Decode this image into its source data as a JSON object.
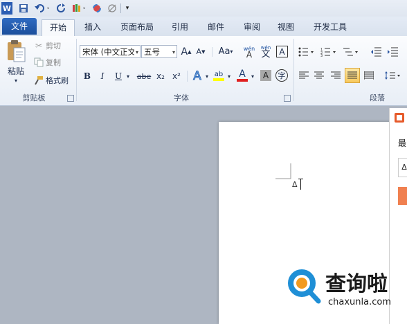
{
  "qat": {
    "icons": [
      "word-logo-icon",
      "save-icon",
      "undo-icon",
      "redo-icon",
      "format-painter-icon",
      "color-icon",
      "clear-icon",
      "customize-icon"
    ]
  },
  "tabs": {
    "file": "文件",
    "items": [
      "开始",
      "插入",
      "页面布局",
      "引用",
      "邮件",
      "审阅",
      "视图",
      "开发工具"
    ]
  },
  "clipboard": {
    "paste": "粘贴",
    "cut": "剪切",
    "copy": "复制",
    "format_painter": "格式刷",
    "group_label": "剪贴板"
  },
  "font": {
    "font_name": "宋体 (中文正文",
    "font_size": "五号",
    "grow": "A",
    "shrink": "A",
    "change_case": "Aa",
    "wen": "wén",
    "wen_char": "文",
    "boxed_a": "A",
    "bold": "B",
    "italic": "I",
    "underline": "U",
    "strike": "abe",
    "subscript": "x₂",
    "superscript": "x²",
    "effects": "A",
    "highlight": "ab",
    "font_color": "A",
    "char_shade": "A",
    "enclose": "字",
    "group_label": "字体"
  },
  "paragraph": {
    "group_label": "段落"
  },
  "side": {
    "heading": "最",
    "symbol": "Δ"
  },
  "document": {
    "marker": "Δ"
  },
  "watermark": {
    "text": "查询啦",
    "domain": "chaxunla.com"
  },
  "colors": {
    "file_tab": "#2a64b8",
    "highlight": "#ffff00",
    "font_color": "#e02020",
    "side_orange": "#f08050",
    "watermark_blue": "#1f8fd6",
    "watermark_orange": "#f29a1f"
  }
}
